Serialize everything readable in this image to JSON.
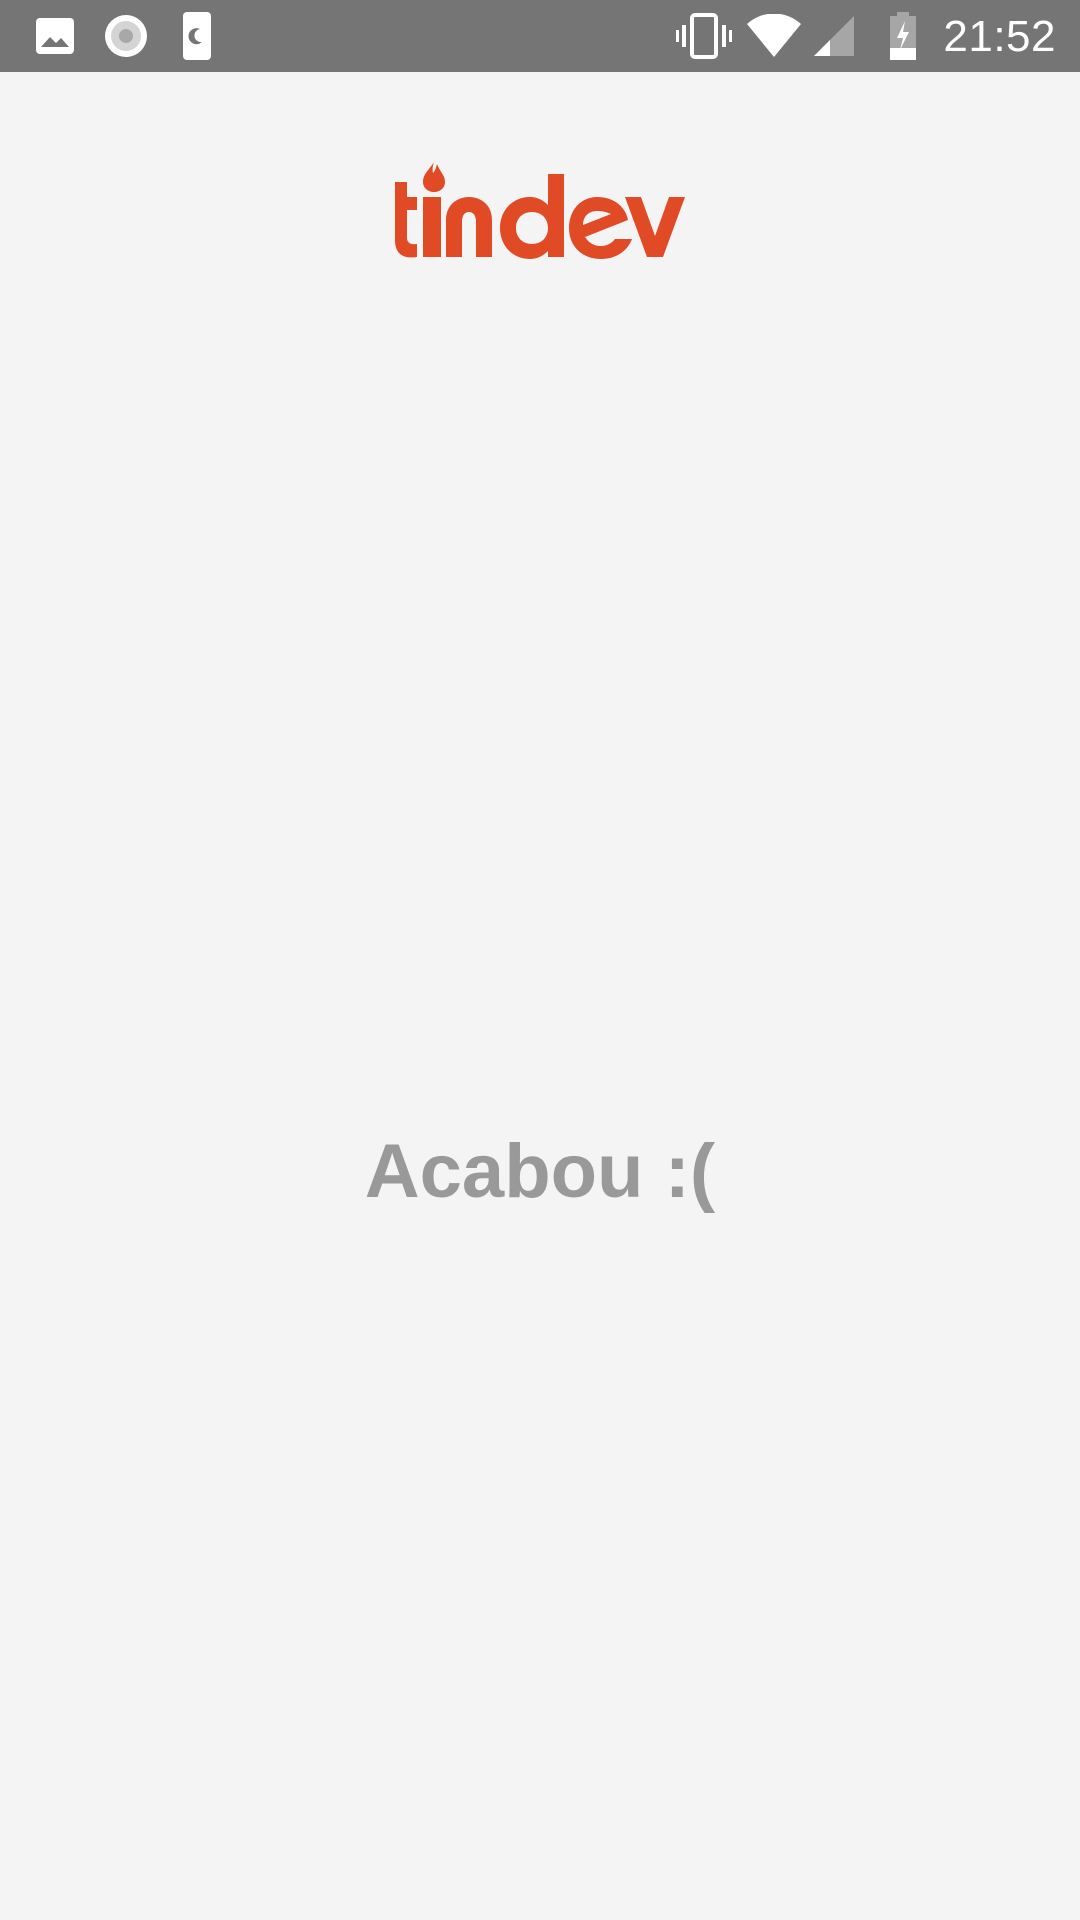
{
  "status_bar": {
    "time": "21:52",
    "left_icons": [
      "image-icon",
      "record-icon",
      "do-not-disturb-icon"
    ],
    "right_icons": [
      "vibrate-icon",
      "wifi-icon",
      "cell-signal-icon",
      "battery-charging-icon"
    ]
  },
  "header": {
    "logo_text": "tindev",
    "logo_color": "#e04a24"
  },
  "main": {
    "empty_message": "Acabou :("
  },
  "colors": {
    "background": "#f4f4f4",
    "status_bar": "#757575",
    "message_text": "#999999"
  }
}
